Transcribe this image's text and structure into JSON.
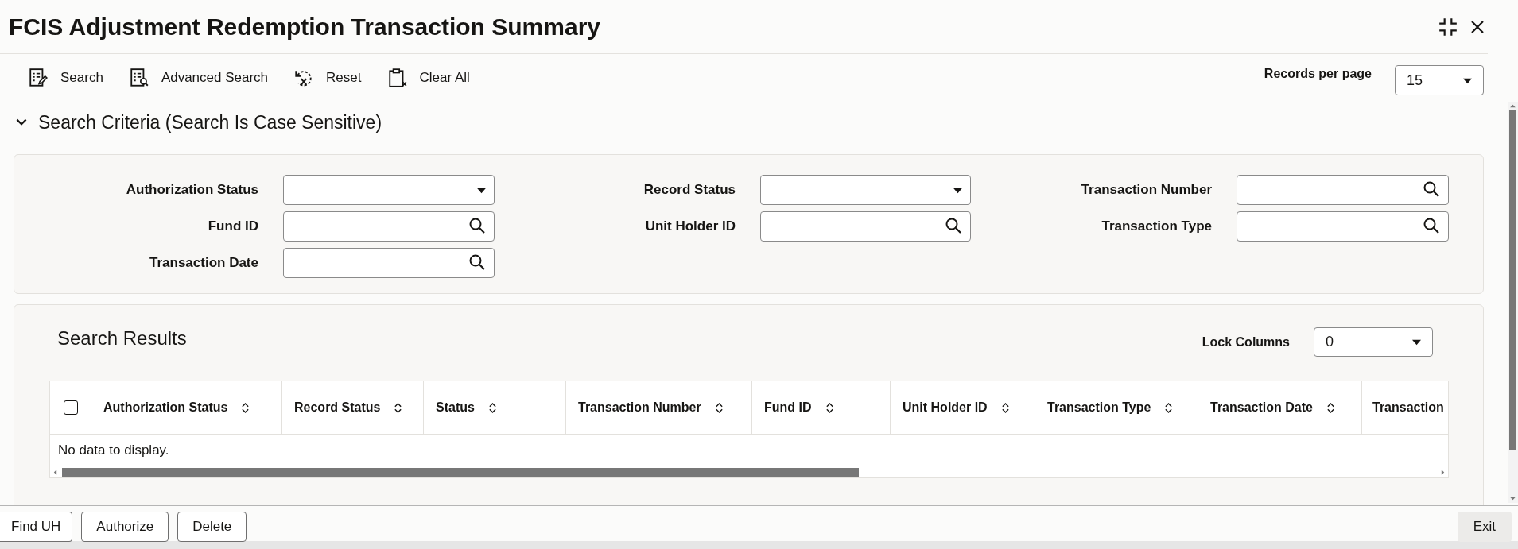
{
  "window": {
    "title": "FCIS Adjustment Redemption Transaction Summary"
  },
  "toolbar": {
    "buttons": [
      {
        "label": "Search",
        "kind": "search"
      },
      {
        "label": "Advanced Search",
        "kind": "advanced"
      },
      {
        "label": "Reset",
        "kind": "reset"
      },
      {
        "label": "Clear All",
        "kind": "clear"
      }
    ],
    "records_per_page": {
      "label": "Records per page",
      "value": "15"
    }
  },
  "search_criteria": {
    "title": "Search Criteria (Search Is Case Sensitive)",
    "expanded": true,
    "fields": [
      {
        "label": "Authorization Status",
        "kind": "select"
      },
      {
        "label": "Record Status",
        "kind": "select"
      },
      {
        "label": "Transaction Number",
        "kind": "lookup"
      },
      {
        "label": "Fund ID",
        "kind": "lookup"
      },
      {
        "label": "Unit Holder ID",
        "kind": "lookup"
      },
      {
        "label": "Transaction Type",
        "kind": "lookup"
      },
      {
        "label": "Transaction Date",
        "kind": "lookup"
      }
    ]
  },
  "search_results": {
    "title": "Search Results",
    "lock_columns": {
      "label": "Lock Columns",
      "value": "0"
    },
    "table": {
      "select_all_checked": false,
      "columns": [
        "Authorization Status",
        "Record Status",
        "Status",
        "Transaction Number",
        "Fund ID",
        "Unit Holder ID",
        "Transaction Type",
        "Transaction Date",
        "Transaction"
      ],
      "empty_message": "No data to display."
    }
  },
  "footer": {
    "buttons": [
      "Find UH",
      "Authorize",
      "Delete"
    ],
    "exit": "Exit"
  }
}
